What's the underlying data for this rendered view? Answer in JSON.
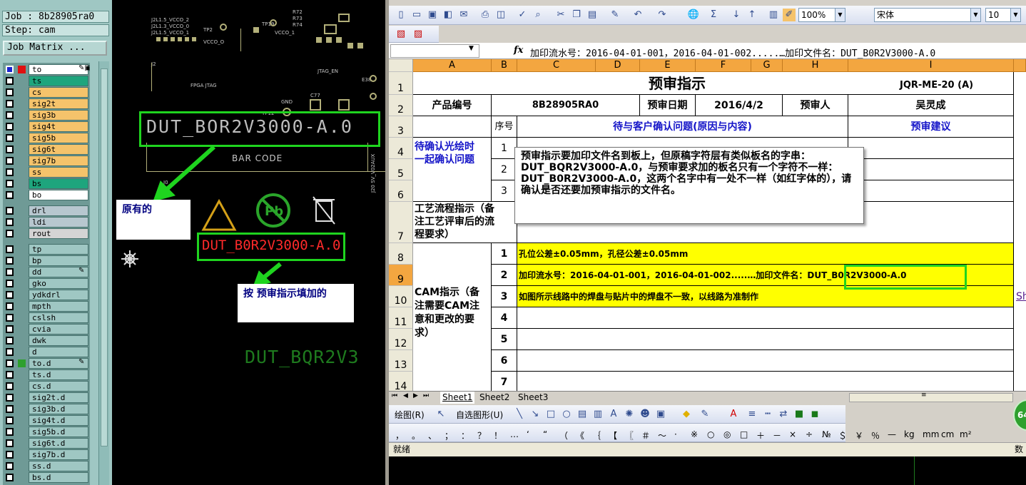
{
  "cam": {
    "job_label": "Job : 8b28905ra0",
    "step_label": "Step: cam",
    "job_matrix_button": "Job Matrix ...",
    "layers": [
      {
        "name": "to",
        "color": "#ffffff",
        "mark": "✎▣"
      },
      {
        "name": "ts",
        "color": "#1ea57d",
        "mark": ""
      },
      {
        "name": "cs",
        "color": "#f5c36b",
        "mark": ""
      },
      {
        "name": "sig2t",
        "color": "#f5c36b",
        "mark": ""
      },
      {
        "name": "sig3b",
        "color": "#f5c36b",
        "mark": ""
      },
      {
        "name": "sig4t",
        "color": "#f5c36b",
        "mark": ""
      },
      {
        "name": "sig5b",
        "color": "#f5c36b",
        "mark": ""
      },
      {
        "name": "sig6t",
        "color": "#f5c36b",
        "mark": ""
      },
      {
        "name": "sig7b",
        "color": "#f5c36b",
        "mark": ""
      },
      {
        "name": "ss",
        "color": "#f5c36b",
        "mark": ""
      },
      {
        "name": "bs",
        "color": "#1ea57d",
        "mark": ""
      },
      {
        "name": "bo",
        "color": "#ffffff",
        "mark": ""
      },
      {
        "name": "drl",
        "color": "#b7c7cf",
        "mark": ""
      },
      {
        "name": "ldi",
        "color": "#b7c7cf",
        "mark": ""
      },
      {
        "name": "rout",
        "color": "#d4d4d4",
        "mark": ""
      },
      {
        "name": "tp",
        "color": "#9fc7c3",
        "mark": ""
      },
      {
        "name": "bp",
        "color": "#9fc7c3",
        "mark": ""
      },
      {
        "name": "dd",
        "color": "#9fc7c3",
        "mark": "✎"
      },
      {
        "name": "gko",
        "color": "#9fc7c3",
        "mark": ""
      },
      {
        "name": "ydkdrl",
        "color": "#9fc7c3",
        "mark": ""
      },
      {
        "name": "mpth",
        "color": "#9fc7c3",
        "mark": ""
      },
      {
        "name": "cslsh",
        "color": "#9fc7c3",
        "mark": ""
      },
      {
        "name": "cvia",
        "color": "#9fc7c3",
        "mark": ""
      },
      {
        "name": "dwk",
        "color": "#9fc7c3",
        "mark": ""
      },
      {
        "name": "d",
        "color": "#9fc7c3",
        "mark": ""
      },
      {
        "name": "to.d",
        "color": "#9fc7c3",
        "mark": "✎"
      },
      {
        "name": "ts.d",
        "color": "#9fc7c3",
        "mark": ""
      },
      {
        "name": "cs.d",
        "color": "#9fc7c3",
        "mark": ""
      },
      {
        "name": "sig2t.d",
        "color": "#9fc7c3",
        "mark": ""
      },
      {
        "name": "sig3b.d",
        "color": "#9fc7c3",
        "mark": ""
      },
      {
        "name": "sig4t.d",
        "color": "#9fc7c3",
        "mark": ""
      },
      {
        "name": "sig5b.d",
        "color": "#9fc7c3",
        "mark": ""
      },
      {
        "name": "sig6t.d",
        "color": "#9fc7c3",
        "mark": ""
      },
      {
        "name": "sig7b.d",
        "color": "#9fc7c3",
        "mark": ""
      },
      {
        "name": "ss.d",
        "color": "#9fc7c3",
        "mark": ""
      },
      {
        "name": "bs.d",
        "color": "#9fc7c3",
        "mark": ""
      }
    ]
  },
  "pcb": {
    "silk_labels": [
      "J2L1.5_VCCO_2",
      "J2L1.3_VCCO_0",
      "J2L1.5_VCCO_1",
      "VCCO_O",
      "TP2",
      "TP19",
      "R72",
      "R73",
      "R74",
      "VCCO_1",
      "FPGA JTAG",
      "JTAG_EN",
      "E38",
      "GND",
      "TP12",
      "C77",
      "J2",
      "J0"
    ],
    "original_text": "DUT_BOR2V3000-A.0",
    "bar_code_label": "BAR  CODE",
    "callout_original": "原有的",
    "added_text": "DUT_B0R2V3000-A.0",
    "callout_added": "按 预审指示填加的",
    "bottom_text": "DUT_BQR2V3",
    "vertical_label": "J20 SV_V02AUX",
    "colors": {
      "callout_border": "#1fd41f",
      "added_text": "#ff2a2a",
      "bottom_text": "#1e7a1e"
    }
  },
  "excel": {
    "zoom": "100%",
    "font_name": "宋体",
    "font_size": "10",
    "name_box": "",
    "fx_label": "fx",
    "formula": "加印流水号：2016-04-01-001，2016-04-01-002.....…加印文件名：DUT_B0R2V3000-A.0",
    "columns": [
      "A",
      "B",
      "C",
      "D",
      "E",
      "F",
      "G",
      "H",
      "I"
    ],
    "rows": [
      "1",
      "2",
      "3",
      "4",
      "5",
      "6",
      "7",
      "8",
      "9",
      "10",
      "11",
      "12",
      "13",
      "14"
    ],
    "sheet": {
      "title": "预审指示",
      "doc_no": "JQR-ME-20 (A)",
      "product_no_label": "产品编号",
      "product_no": "8B28905RA0",
      "review_date_label": "预审日期",
      "review_date": "2016/4/2",
      "reviewer_label": "预审人",
      "reviewer": "吴灵成",
      "seq_label": "序号",
      "pending_header": "待与客户确认问题(原因与内容)",
      "suggest_header": "预审建议",
      "confirm_label_1": "待确认光绘时",
      "confirm_label_2": "一起确认问题",
      "process_label_1": "工艺流程指示（备",
      "process_label_2": "注工艺评审后的流",
      "process_label_3": "程要求）",
      "cam_label_1": "CAM指示（备",
      "cam_label_2": "注需要CAM注",
      "cam_label_3": "意和更改的要",
      "cam_label_4": "求）",
      "seq_top": [
        "1",
        "2",
        "3"
      ],
      "cam_seq": [
        "1",
        "2",
        "3",
        "4",
        "5",
        "6",
        "7"
      ],
      "cam_lines": [
        "孔位公差±0.05mm，孔径公差±0.05mm",
        "加印流水号：2016-04-01-001，2016-04-01-002.....…加印文件名：",
        "如图所示线路中的焊盘与贴片中的焊盘不一致，以线路为准制作"
      ],
      "cam_file": "DUT_B0R2V3000-A.0",
      "side_link": "Sh"
    },
    "comment": "预审指示要加印文件名到板上，但原稿字符层有类似板名的字串：DUT_BQR2V3000-A.0，与预审要求加的板名只有一个字符不一样：DUT_B0R2V3000-A.0，这两个名字中有一处不一样（如红字体的），请确认是否还要加预审指示的文件名。",
    "tabs": [
      "Sheet1",
      "Sheet2",
      "Sheet3"
    ],
    "draw_label": "绘图(R)",
    "autoshape_label": "自选图形(U)",
    "symbols": [
      "，",
      "。",
      "、",
      "；",
      "：",
      "？",
      "！",
      "…",
      "‘",
      "“",
      "（",
      "《",
      "｛",
      "【",
      "〖",
      "＃",
      "～",
      "·",
      "※",
      "○",
      "◎",
      "□",
      "＋",
      "－",
      "×",
      "÷",
      "№",
      "＄",
      "￥",
      "％",
      "—",
      "kg",
      "mm",
      "cm",
      "m²"
    ],
    "status": "就绪",
    "status_right": "数",
    "badge": "64"
  }
}
